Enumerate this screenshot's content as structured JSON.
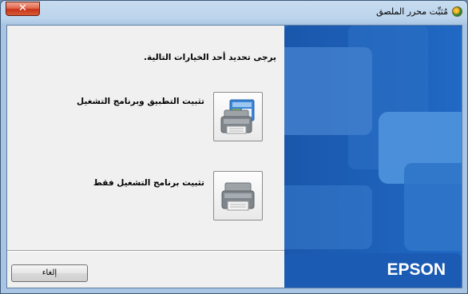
{
  "window": {
    "title": "مُثبِّت محرر الملصق",
    "close_label": "✕"
  },
  "content": {
    "prompt": "يرجى تحديد أحد الخيارات التالية.",
    "options": [
      {
        "label": "تثبيت التطبيق وبرنامج التشغيل",
        "icon": "printer-with-app-icon"
      },
      {
        "label": "تثبيت برنامج التشغيل فقط",
        "icon": "printer-icon"
      }
    ],
    "cancel_label": "إلغاء"
  },
  "brand": {
    "logo_text": "EPSON",
    "panel_color": "#1f63b9"
  }
}
